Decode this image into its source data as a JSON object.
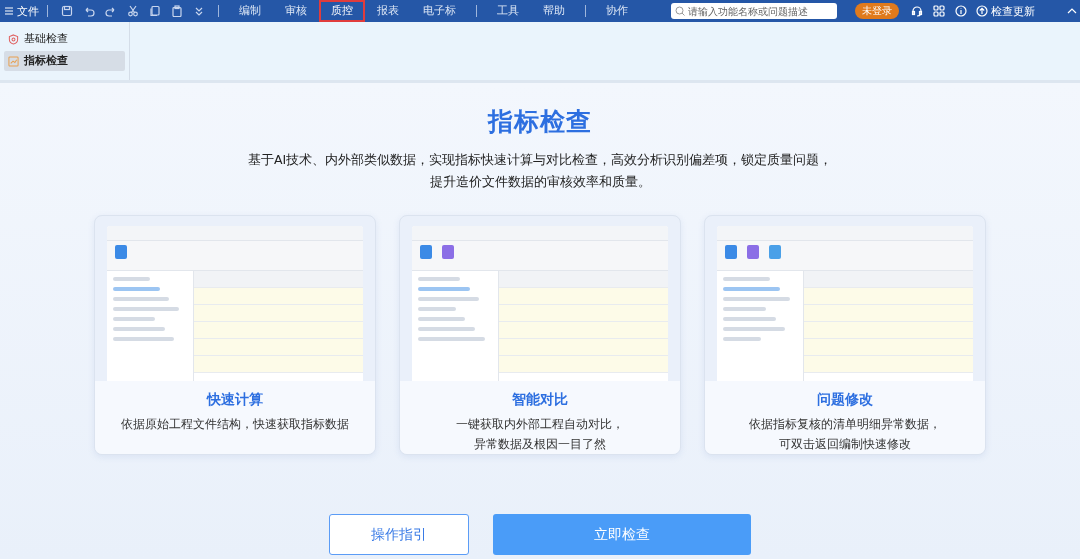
{
  "menu": {
    "file": "文件",
    "tabs": [
      {
        "label": "编制",
        "selected": false
      },
      {
        "label": "审核",
        "selected": false
      },
      {
        "label": "质控",
        "selected": true
      },
      {
        "label": "报表",
        "selected": false
      },
      {
        "label": "电子标",
        "selected": false
      },
      {
        "label": "工具",
        "selected": false
      },
      {
        "label": "帮助",
        "selected": false
      },
      {
        "label": "协作",
        "selected": false
      }
    ],
    "search": {
      "placeholder": "请输入功能名称或问题描述"
    },
    "login_badge": "未登录",
    "update": "检查更新"
  },
  "sidebar": {
    "items": [
      {
        "label": "基础检查",
        "kind": "shield",
        "selected": false
      },
      {
        "label": "指标检查",
        "kind": "chart",
        "selected": true
      }
    ]
  },
  "main": {
    "title": "指标检查",
    "intro": [
      "基于AI技术、内外部类似数据，实现指标快速计算与对比检查，高效分析识别偏差项，锁定质量问题，",
      "提升造价文件数据的审核效率和质量。"
    ],
    "cards": [
      {
        "title": "快速计算",
        "lines": [
          "依据原始工程文件结构，快速获取指标数据"
        ]
      },
      {
        "title": "智能对比",
        "lines": [
          "一键获取内外部工程自动对比，",
          "异常数据及根因一目了然"
        ]
      },
      {
        "title": "问题修改",
        "lines": [
          "依据指标复核的清单明细异常数据，",
          "可双击返回编制快速修改"
        ]
      }
    ],
    "buttons": {
      "guide": "操作指引",
      "start": "立即检查"
    }
  }
}
